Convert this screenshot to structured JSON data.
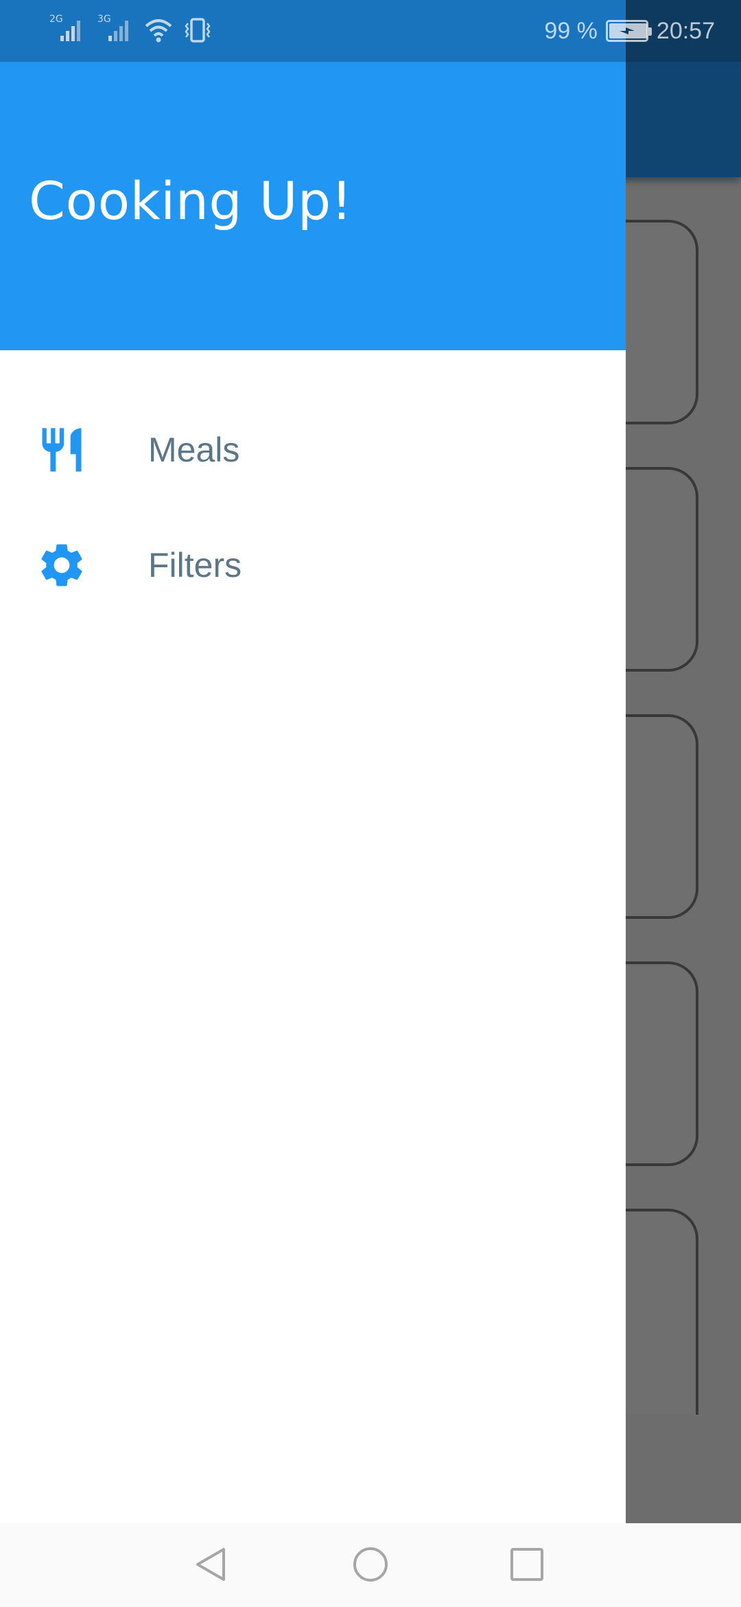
{
  "status_bar": {
    "network_1": "2G",
    "network_2": "3G",
    "battery_percent": "99 %",
    "battery_level": 0.99,
    "time": "20:57",
    "icons": [
      "signal-icon",
      "signal-icon",
      "wifi-icon",
      "vibrate-icon",
      "battery-charging-icon"
    ]
  },
  "drawer": {
    "title": "Cooking Up!",
    "items": [
      {
        "label": "Meals",
        "icon": "restaurant-icon"
      },
      {
        "label": "Filters",
        "icon": "settings-icon"
      }
    ]
  },
  "nav_bar": {
    "buttons": [
      "back-icon",
      "home-icon",
      "recents-icon"
    ]
  },
  "colors": {
    "primary": "#2196F3",
    "drawer_text": "#5b7688",
    "scrim": "rgba(0,0,0,0.54)"
  }
}
